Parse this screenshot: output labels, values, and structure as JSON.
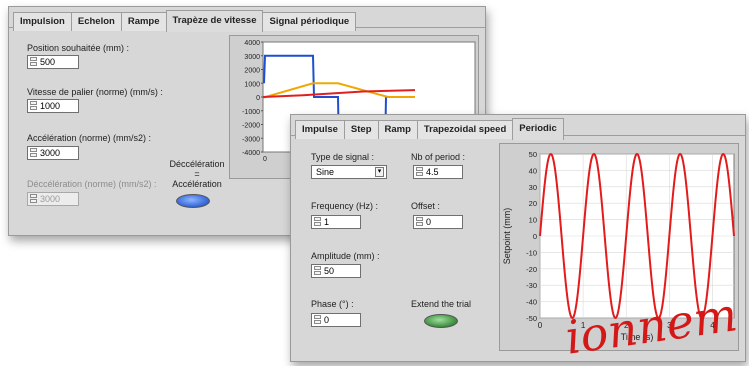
{
  "back_panel": {
    "tabs": [
      "Impulsion",
      "Echelon",
      "Rampe",
      "Trapèze de vitesse",
      "Signal périodique"
    ],
    "active_tab": "Trapèze de vitesse",
    "fields": {
      "position_label": "Position souhaitée (mm) :",
      "position_value": "500",
      "vitesse_label": "Vitesse de palier (norme) (mm/s) :",
      "vitesse_value": "1000",
      "acceleration_label": "Accélération (norme)  (mm/s2) :",
      "acceleration_value": "3000",
      "deceleration_label": "Déccélération (norme) (mm/s2) :",
      "deceleration_value": "3000"
    },
    "toggle": {
      "line1": "Déccélération",
      "line2": "=",
      "line3": "Accélération",
      "state": "on",
      "color": "#2f63d6"
    },
    "graph": {
      "y_ticks": [
        "4000",
        "3000",
        "2000",
        "1000",
        "0",
        "-1000",
        "-2000",
        "-3000",
        "-4000"
      ],
      "x_ticks": [
        "0"
      ],
      "series_colors": [
        "#1f4fd0",
        "#f0a800",
        "#e02020"
      ]
    }
  },
  "front_panel": {
    "tabs": [
      "Impulse",
      "Step",
      "Ramp",
      "Trapezoidal speed",
      "Periodic"
    ],
    "active_tab": "Periodic",
    "fields": {
      "signal_type_label": "Type de signal :",
      "signal_type_value": "Sine",
      "nb_period_label": "Nb of period :",
      "nb_period_value": "4.5",
      "frequency_label": "Frequency (Hz) :",
      "frequency_value": "1",
      "offset_label": "Offset :",
      "offset_value": "0",
      "amplitude_label": "Amplitude (mm) :",
      "amplitude_value": "50",
      "phase_label": "Phase (°) :",
      "phase_value": "0",
      "extend_label": "Extend the trial"
    },
    "extend_toggle": {
      "state": "on",
      "color": "#3a8a3a"
    }
  },
  "watermark": "ionnem",
  "chart_data": {
    "type": "line",
    "xlabel": "Time (s)",
    "ylabel": "Setpoint (mm)",
    "xlim": [
      0,
      4.5
    ],
    "ylim": [
      -50,
      50
    ],
    "x_ticks": [
      "0",
      "1",
      "2",
      "3",
      "4"
    ],
    "y_ticks": [
      "50",
      "40",
      "30",
      "20",
      "10",
      "0",
      "-10",
      "-20",
      "-30",
      "-40",
      "-50"
    ],
    "series": [
      {
        "function": "sine",
        "amplitude": 50,
        "frequency": 1,
        "offset": 0,
        "phase": 0,
        "color": "#e41b1b"
      }
    ],
    "grid": true
  }
}
